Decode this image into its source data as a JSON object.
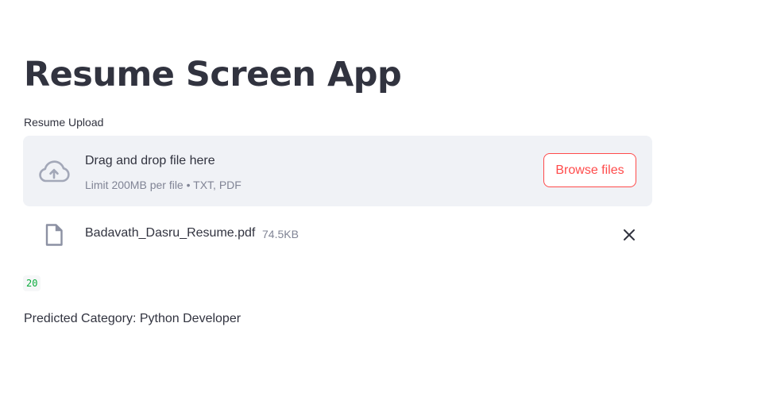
{
  "app": {
    "title": "Resume Screen App"
  },
  "uploader": {
    "label": "Resume Upload",
    "dropzone_text": "Drag and drop file here",
    "limit_text": "Limit 200MB per file • TXT, PDF",
    "browse_label": "Browse files",
    "cloud_icon": "cloud-upload-icon",
    "accent_color": "#ff4b4b",
    "dropzone_bg": "#f0f2f6"
  },
  "uploaded_file": {
    "name": "Badavath_Dasru_Resume.pdf",
    "size": "74.5KB",
    "file_icon": "file-icon",
    "remove_icon": "close-icon"
  },
  "output": {
    "code_value": "20",
    "code_color": "#09ab3b",
    "prediction_text": "Predicted Category: Python Developer"
  }
}
